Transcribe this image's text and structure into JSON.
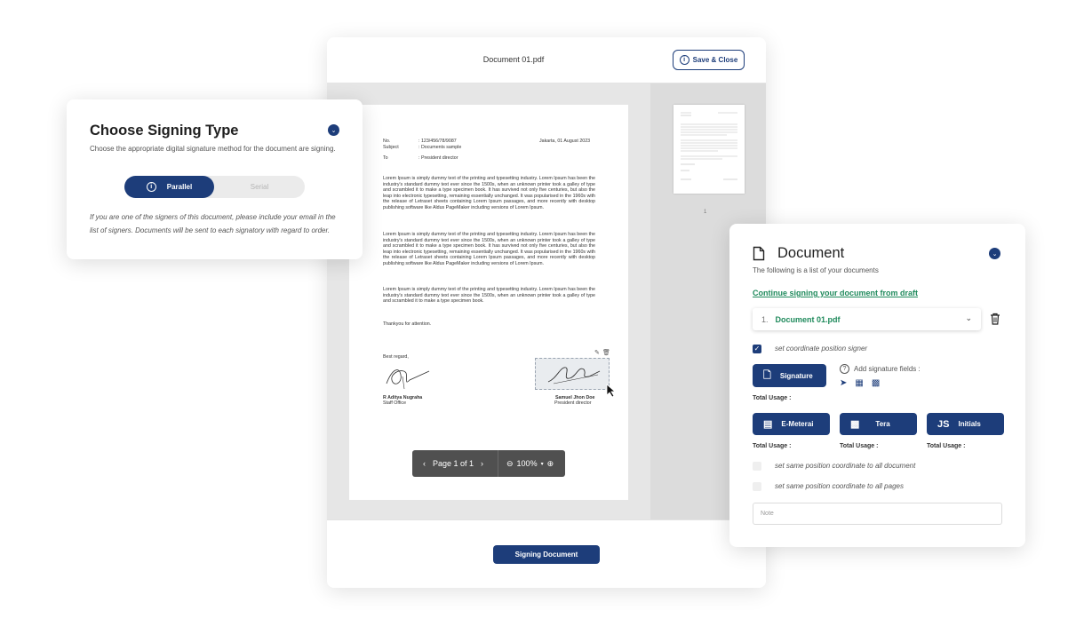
{
  "viewer": {
    "file_title": "Document 01.pdf",
    "save_label": "Save & Close",
    "sign_button": "Signing Document",
    "thumb_page_number": "1",
    "pager": {
      "page_text": "Page 1 of 1",
      "zoom": "100%"
    }
  },
  "letter": {
    "meta": [
      {
        "k": "No.",
        "v": ": 123/456/78/9087"
      },
      {
        "k": "Subject",
        "v": ": Documents sample"
      },
      {
        "k": "To",
        "v": ": President director"
      }
    ],
    "place_date": "Jakarta, 01 August 2023",
    "para1": "Lorem Ipsum is simply dummy text of the printing and typesetting industry. Lorem Ipsum has been the industry's standard dummy text ever since the 1500s, when an unknown printer took a galley of type and scrambled it to make a type specimen book. It has survived not only five centuries, but also the leap into electronic typesetting, remaining essentially unchanged. It was popularised in the 1960s with the release of Letraset sheets containing Lorem Ipsum passages, and more recently with desktop publishing software like Aldus PageMaker including versions of Lorem Ipsum.",
    "para2": "Lorem Ipsum is simply dummy text of the printing and typesetting industry. Lorem Ipsum has been the industry's standard dummy text ever since the 1500s, when an unknown printer took a galley of type and scrambled it to make a type specimen book. It has survived not only five centuries, but also the leap into electronic typesetting, remaining essentially unchanged. It was popularised in the 1960s with the release of Letraset sheets containing Lorem Ipsum passages, and more recently with desktop publishing software like Aldus PageMaker including versions of Lorem Ipsum.",
    "para3": "Lorem Ipsum is simply dummy text of the printing and typesetting industry. Lorem Ipsum has been the industry's standard dummy text ever since the 1500s, when an unknown printer took a galley of type and scrambled it to make a type specimen book.",
    "closing": "Thankyou for attention.",
    "regards": "Best regard,",
    "signer1_name": "R Aditya Nugraha",
    "signer1_role": "Staff Office",
    "signer2_name": "Samuel Jhon Doe",
    "signer2_role": "President director"
  },
  "signing_type": {
    "title": "Choose Signing Type",
    "description": "Choose the appropriate digital signature method for the document are signing.",
    "option_active": "Parallel",
    "option_inactive": "Serial",
    "note": "If you are one of the signers of this document, please include your email in the list of signers. Documents will be sent to each signatory with regard to order."
  },
  "document_panel": {
    "title": "Document",
    "subtitle": "The following is a list of your documents",
    "draft_link": "Continue signing your document from draft",
    "doc_index": "1.",
    "doc_name": "Document 01.pdf",
    "set_coordinate": "set coordinate position signer",
    "signature_button": "Signature",
    "add_fields": "Add signature fields :",
    "total_usage": "Total Usage :",
    "emeterai_button": "E-Meterai",
    "tera_button": "Tera",
    "initials_button": "Initials",
    "initials_prefix": "JS",
    "same_all_docs": "set same position coordinate to all document",
    "same_all_pages": "set same position coordinate to all pages",
    "note_placeholder": "Note"
  },
  "colors": {
    "primary": "#1d3d7a",
    "accent_green": "#1f8a5c"
  }
}
